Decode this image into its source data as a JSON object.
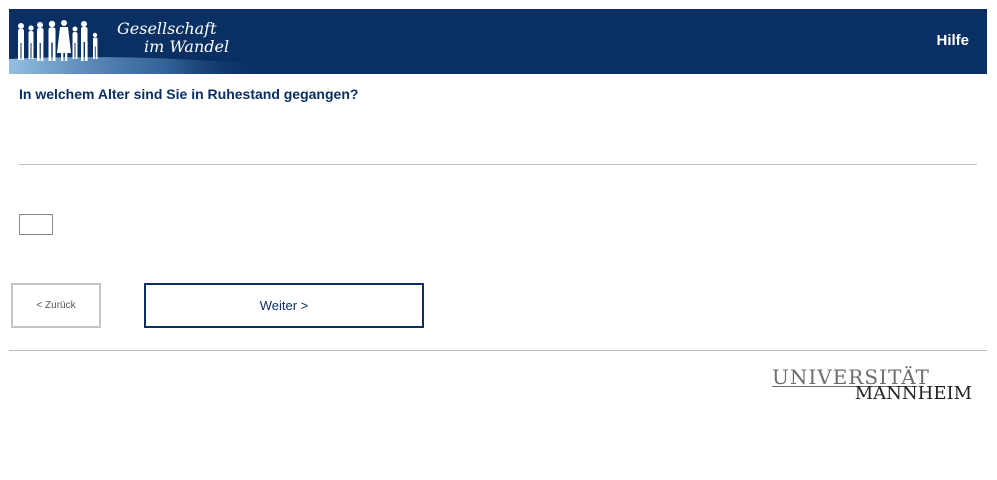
{
  "header": {
    "logo_line1": "Gesellschaft",
    "logo_line2": "im Wandel",
    "help_label": "Hilfe",
    "brand_color": "#0a2f63"
  },
  "question": {
    "text": "In welchem Alter sind Sie in Ruhestand gegangen?",
    "answer_value": ""
  },
  "navigation": {
    "back_label": "< Zurück",
    "next_label": "Weiter >"
  },
  "footer": {
    "logo_line1": "UNIVERSITÄT",
    "logo_line2": "MANNHEIM"
  }
}
